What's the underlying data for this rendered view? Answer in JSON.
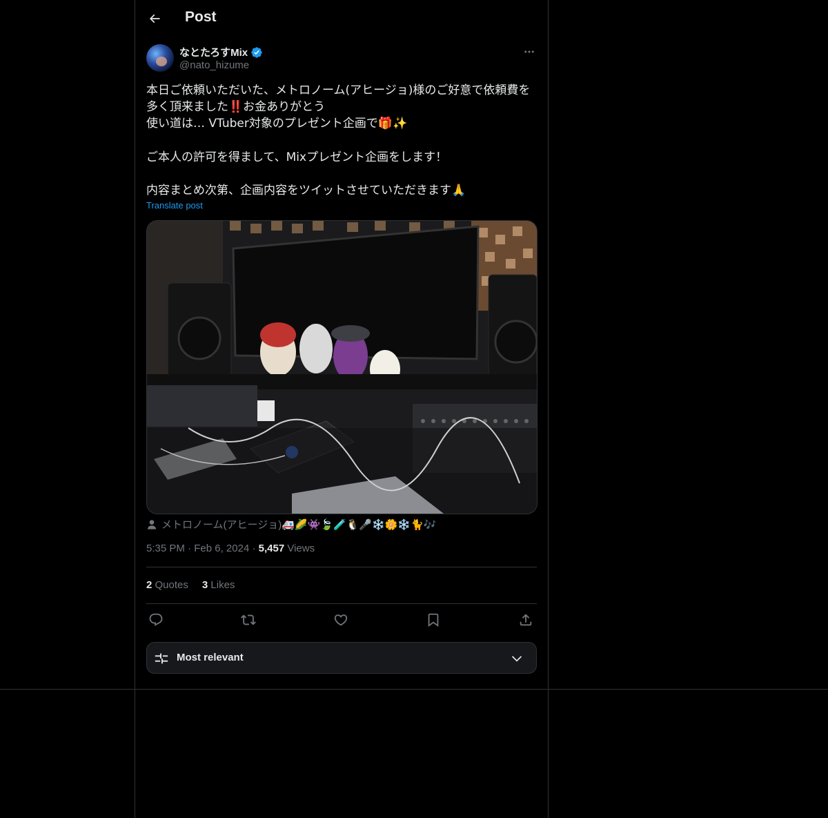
{
  "header": {
    "title": "Post"
  },
  "author": {
    "name": "なとたろすMix",
    "handle": "@nato_hizume"
  },
  "tweet": {
    "text": "本日ご依頼いただいた、メトロノーム(アヒージョ)様のご好意で依頼費を多く頂来ました‼️お金ありがとう\n使い道は… VTuber対象のプレゼント企画で🎁✨\n\nご本人の許可を得まして、Mixプレゼント企画をします！\n\n内容まとめ次第、企画内容をツイットさせていただきます🙏",
    "translate_label": "Translate post"
  },
  "tagged_user": "メトロノーム(アヒージョ)🚑🌽👾🍃🧪🐧🎤❄️🌼❄️🐈🎶",
  "meta": {
    "time": "5:35 PM",
    "date": "Feb 6, 2024",
    "views_count": "5,457",
    "views_label": "Views",
    "sep": "·"
  },
  "stats": {
    "quotes_count": "2",
    "quotes_label": "Quotes",
    "likes_count": "3",
    "likes_label": "Likes"
  },
  "icons": [
    "back-arrow-icon",
    "verified-icon",
    "more-icon",
    "reply-icon",
    "repost-icon",
    "like-icon",
    "bookmark-icon",
    "share-icon",
    "sort-icon",
    "chevron-down-icon",
    "person-icon"
  ],
  "colors": {
    "accent": "#1d9bf0",
    "text": "#e7e9ea",
    "muted": "#71767b",
    "border": "#2f3336",
    "background": "#000000"
  },
  "sort": {
    "label": "Most relevant"
  }
}
